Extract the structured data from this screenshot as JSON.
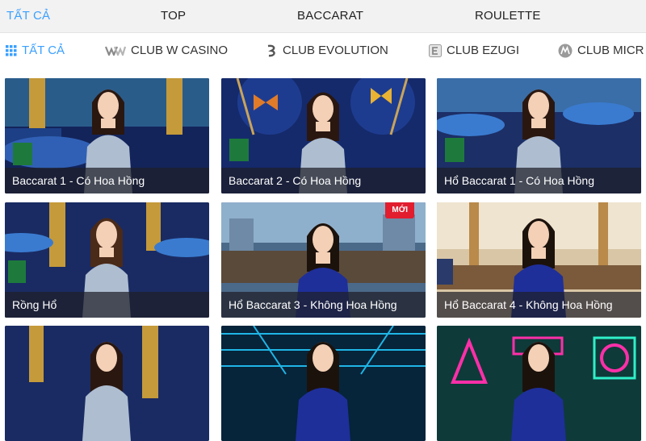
{
  "top_tabs": [
    {
      "label": "TẤT CẢ",
      "active": true
    },
    {
      "label": "TOP",
      "active": false
    },
    {
      "label": "BACCARAT",
      "active": false
    },
    {
      "label": "ROULETTE",
      "active": false
    }
  ],
  "sub_tabs": [
    {
      "label": "TẤT CẢ",
      "icon": "grid-icon",
      "active": true
    },
    {
      "label": "CLUB W CASINO",
      "icon": "w-casino-logo-icon",
      "active": false
    },
    {
      "label": "CLUB EVOLUTION",
      "icon": "evolution-logo-icon",
      "active": false
    },
    {
      "label": "CLUB EZUGI",
      "icon": "ezugi-logo-icon",
      "active": false
    },
    {
      "label": "CLUB MICR",
      "icon": "microgaming-logo-icon",
      "active": false
    }
  ],
  "games": [
    {
      "title": "Baccarat 1 - Có Hoa Hồng",
      "badge": ""
    },
    {
      "title": "Baccarat 2 - Có Hoa Hồng",
      "badge": ""
    },
    {
      "title": "Hổ Baccarat 1 - Có Hoa Hồng",
      "badge": ""
    },
    {
      "title": "Rồng Hổ",
      "badge": ""
    },
    {
      "title": "Hổ Baccarat 3 - Không Hoa Hồng",
      "badge": "MỚI"
    },
    {
      "title": "Hổ Baccarat 4 - Không Hoa Hồng",
      "badge": ""
    },
    {
      "title": "",
      "badge": ""
    },
    {
      "title": "",
      "badge": ""
    },
    {
      "title": "",
      "badge": ""
    }
  ],
  "colors": {
    "accent": "#3aa0ff",
    "badge": "#e11d2e"
  }
}
